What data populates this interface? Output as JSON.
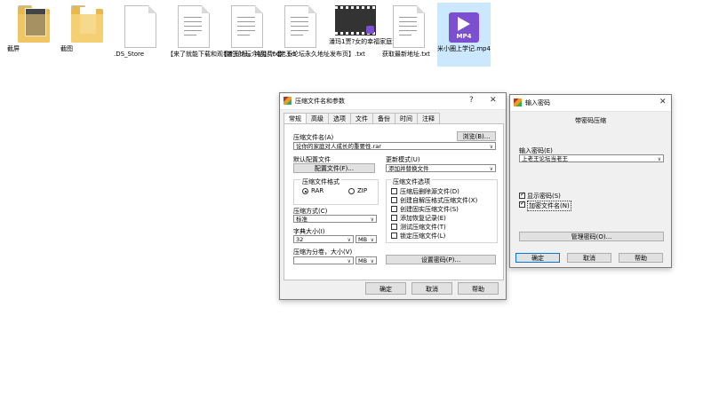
{
  "desktop_files": [
    {
      "label": "截屏",
      "type": "folder"
    },
    {
      "label": "截图",
      "type": "folder"
    },
    {
      "label": ".DS_Store",
      "type": "doc"
    },
    {
      "label": "【来了就能下载和观看的论坛，纯免费！】.txt",
      "type": "doc"
    },
    {
      "label": "【老王论坛介绍】.txt",
      "type": "doc"
    },
    {
      "label": "【老王论坛永久地址发布页】.txt",
      "type": "doc"
    },
    {
      "label": "潘玛1贾?女的幸福家庭生活.MP4",
      "type": "video"
    },
    {
      "label": "获取最新地址.txt",
      "type": "doc"
    },
    {
      "label": "米小圈上学记.mp4",
      "type": "mp4",
      "badge": "MP4"
    }
  ],
  "archive_dialog": {
    "title": "压缩文件名和参数",
    "help_btn": "?",
    "close_btn": "✕",
    "tabs": [
      "常规",
      "高级",
      "选项",
      "文件",
      "备份",
      "时间",
      "注释"
    ],
    "archive_name_label": "压缩文件名(A)",
    "browse_btn": "浏览(B)...",
    "archive_name_value": "论你的家庭对人成长的重要性.rar",
    "default_profile_label": "默认配置文件",
    "profile_btn": "配置文件(F)...",
    "update_mode_label": "更新模式(U)",
    "update_mode_value": "添加并替换文件",
    "format_label": "压缩文件格式",
    "format_rar": "RAR",
    "format_zip": "ZIP",
    "options_label": "压缩文件选项",
    "options": [
      {
        "label": "压缩后删除源文件(D)",
        "checked": false
      },
      {
        "label": "创建自解压格式压缩文件(X)",
        "checked": false
      },
      {
        "label": "创建固实压缩文件(S)",
        "checked": false
      },
      {
        "label": "添加恢复记录(E)",
        "checked": false
      },
      {
        "label": "测试压缩文件(T)",
        "checked": false
      },
      {
        "label": "锁定压缩文件(L)",
        "checked": false
      }
    ],
    "method_label": "压缩方式(C)",
    "method_value": "标准",
    "dict_label": "字典大小(I)",
    "dict_value": "32",
    "dict_unit": "MB",
    "split_label": "压缩为分卷，大小(V)",
    "split_value": "",
    "split_unit": "MB",
    "set_password_btn": "设置密码(P)...",
    "ok_btn": "确定",
    "cancel_btn": "取消",
    "help_button": "帮助"
  },
  "password_dialog": {
    "title": "输入密码",
    "close_btn": "✕",
    "subtitle": "带密码压缩",
    "enter_label": "输入密码(E)",
    "password_value": "上老王论坛当老王",
    "show_password": "显示密码(S)",
    "encrypt_names": "加密文件名(N)",
    "manage_btn": "管理密码(O)...",
    "ok_btn": "确定",
    "cancel_btn": "取消",
    "help_btn": "帮助"
  },
  "colors": {
    "selection": "#cce8ff",
    "accent": "#0078d7",
    "mp4": "#7b4fcf"
  }
}
